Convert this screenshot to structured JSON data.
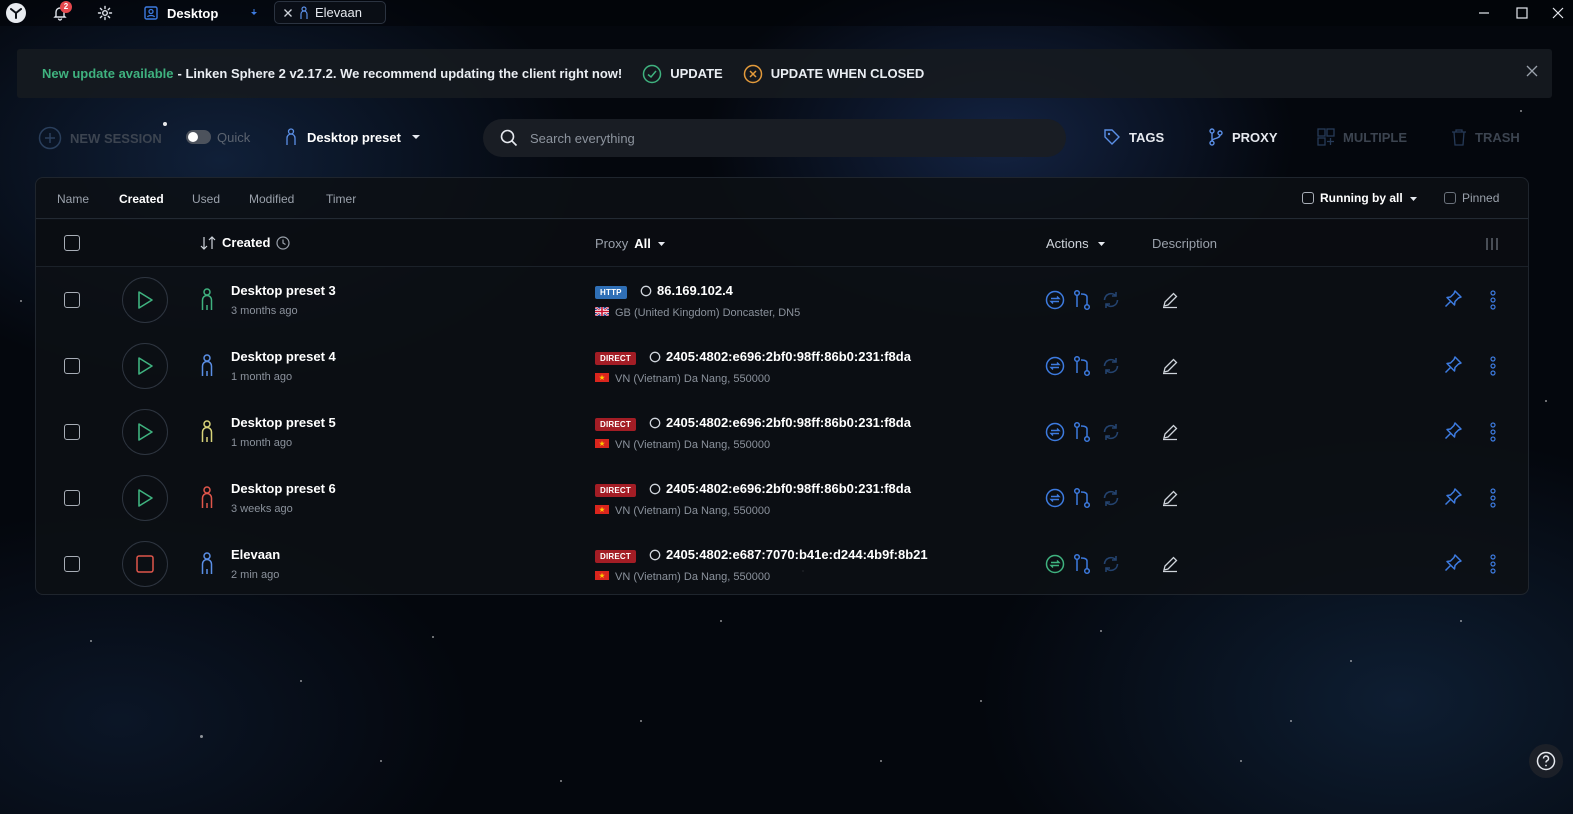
{
  "titlebar": {
    "notification_count": "2",
    "active_tab": "Desktop",
    "second_tab": "Elevaan"
  },
  "banner": {
    "highlight": "New update available",
    "message": "- Linken Sphere 2 v2.17.2.  We recommend updating the client right now!",
    "update_label": "UPDATE",
    "update_when_closed_label": "UPDATE WHEN CLOSED"
  },
  "toolbar": {
    "new_session_label": "NEW SESSION",
    "quick_label": "Quick",
    "preset_label": "Desktop preset",
    "search_placeholder": "Search everything",
    "tags_label": "TAGS",
    "proxy_label": "PROXY",
    "multiple_label": "MULTIPLE",
    "trash_label": "TRASH"
  },
  "sortbar": {
    "items": [
      "Name",
      "Created",
      "Used",
      "Modified",
      "Timer"
    ],
    "active": "Created",
    "running_label": "Running by all",
    "pinned_label": "Pinned"
  },
  "table_header": {
    "created_label": "Created",
    "proxy_label": "Proxy",
    "proxy_filter": "All",
    "actions_label": "Actions",
    "description_label": "Description"
  },
  "colors": {
    "accent_blue": "#3d7be0",
    "green": "#3fb27f",
    "direct_badge": "#a31d25",
    "http_badge": "#2f6fb6"
  },
  "sessions": [
    {
      "name": "Desktop preset 3",
      "time": "3 months ago",
      "proxy_type": "HTTP",
      "ip": "86.169.102.4",
      "location": "GB (United Kingdom) Doncaster, DN5",
      "flag": "uk-flag",
      "person_color": "#3fb27f",
      "state": "stopped"
    },
    {
      "name": "Desktop preset 4",
      "time": "1 month ago",
      "proxy_type": "DIRECT",
      "ip": "2405:4802:e696:2bf0:98ff:86b0:231:f8da",
      "location": "VN (Vietnam) Da Nang, 550000",
      "flag": "vn-flag",
      "person_color": "#5b8fe6",
      "state": "stopped"
    },
    {
      "name": "Desktop preset 5",
      "time": "1 month ago",
      "proxy_type": "DIRECT",
      "ip": "2405:4802:e696:2bf0:98ff:86b0:231:f8da",
      "location": "VN (Vietnam) Da Nang, 550000",
      "flag": "vn-flag",
      "person_color": "#d9d47a",
      "state": "stopped"
    },
    {
      "name": "Desktop preset 6",
      "time": "3 weeks ago",
      "proxy_type": "DIRECT",
      "ip": "2405:4802:e696:2bf0:98ff:86b0:231:f8da",
      "location": "VN (Vietnam) Da Nang, 550000",
      "flag": "vn-flag",
      "person_color": "#e0564b",
      "state": "stopped"
    },
    {
      "name": "Elevaan",
      "time": "2 min ago",
      "proxy_type": "DIRECT",
      "ip": "2405:4802:e687:7070:b41e:d244:4b9f:8b21",
      "location": "VN (Vietnam) Da Nang, 550000",
      "flag": "vn-flag",
      "person_color": "#5b8fe6",
      "state": "running"
    }
  ]
}
